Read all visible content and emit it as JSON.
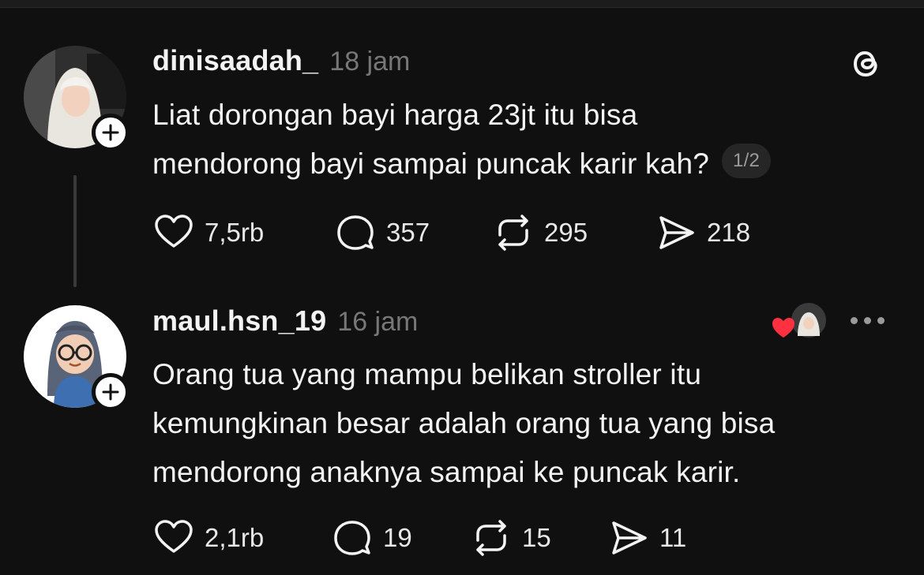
{
  "posts": [
    {
      "username": "dinisaadah_",
      "time": "18 jam",
      "text_lines": [
        "Liat dorongan bayi harga 23jt itu bisa",
        "mendorong bayi sampai puncak karir kah?"
      ],
      "pager": "1/2",
      "likes": "7,5rb",
      "replies": "357",
      "reposts": "295",
      "shares": "218"
    },
    {
      "username": "maul.hsn_19",
      "time": "16 jam",
      "text_lines": [
        "Orang tua yang mampu belikan stroller itu",
        "kemungkinan besar adalah orang tua yang bisa",
        "mendorong anaknya sampai ke puncak karir."
      ],
      "likes": "2,1rb",
      "replies": "19",
      "reposts": "15",
      "shares": "11"
    }
  ],
  "icons": {
    "logo": "threads-logo-icon",
    "like": "heart-icon",
    "reply": "comment-bubble-icon",
    "repost": "repost-icon",
    "share": "send-icon",
    "more": "more-dots-icon",
    "follow": "plus-icon"
  },
  "colors": {
    "background": "#101010",
    "text": "#f3f3f3",
    "muted": "#777777",
    "heart": "#ff3040"
  }
}
